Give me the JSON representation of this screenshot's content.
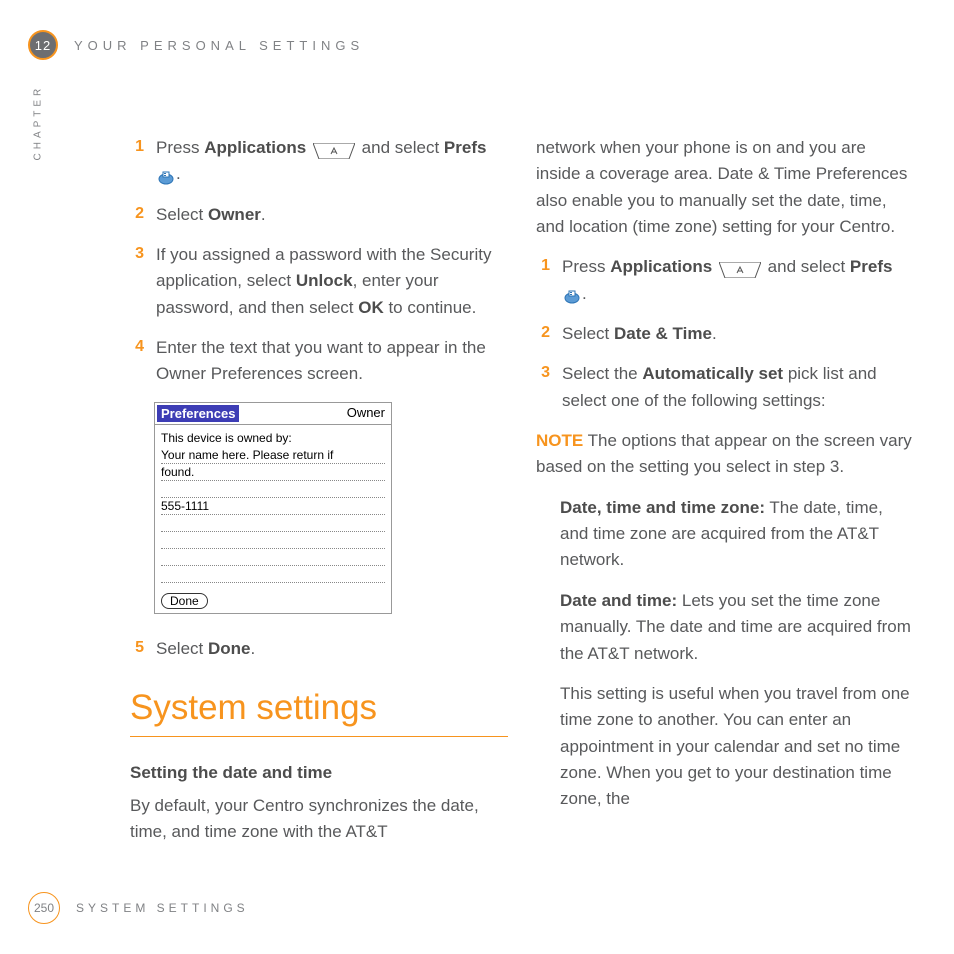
{
  "header": {
    "chapter_number": "12",
    "title": "YOUR PERSONAL SETTINGS",
    "chapter_label": "CHAPTER"
  },
  "footer": {
    "page_number": "250",
    "title": "SYSTEM SETTINGS"
  },
  "left": {
    "steps": {
      "s1": {
        "n": "1",
        "a": "Press ",
        "b": "Applications",
        "c": " and select ",
        "d": "Prefs",
        "e": "."
      },
      "s2": {
        "n": "2",
        "a": "Select ",
        "b": "Owner",
        "c": "."
      },
      "s3": {
        "n": "3",
        "a": "If you assigned a password with the Security application, select ",
        "b": "Unlock",
        "c": ", enter your password, and then select ",
        "d": "OK",
        "e": " to continue."
      },
      "s4": {
        "n": "4",
        "a": "Enter the text that you want to appear in the Owner Preferences screen."
      },
      "s5": {
        "n": "5",
        "a": "Select ",
        "b": "Done",
        "c": "."
      }
    },
    "h2": "System settings",
    "h3": "Setting the date and time",
    "intro": "By default, your Centro synchronizes the date, time, and time zone with the AT&T"
  },
  "screenshot": {
    "title_left": "Preferences",
    "title_right": "Owner",
    "label": "This device is owned by:",
    "line1": "Your name here. Please return if",
    "line2": "found.",
    "line3": "555-1111",
    "done": "Done"
  },
  "right": {
    "cont": "network when your phone is on and you are inside a coverage area. Date & Time Preferences also enable you to manually set the date, time, and location (time zone) setting for your Centro.",
    "steps": {
      "s1": {
        "n": "1",
        "a": "Press ",
        "b": "Applications",
        "c": " and select ",
        "d": "Prefs",
        "e": "."
      },
      "s2": {
        "n": "2",
        "a": "Select ",
        "b": "Date & Time",
        "c": "."
      },
      "s3": {
        "n": "3",
        "a": "Select the ",
        "b": "Automatically set",
        "c": " pick list and select one of the following settings:"
      }
    },
    "note_label": "NOTE",
    "note_text": " The options that appear on the screen vary based on the setting you select in step 3.",
    "opt1": {
      "label": "Date, time and time zone:",
      "text": " The date, time, and time zone are acquired from the AT&T network."
    },
    "opt2": {
      "label": "Date and time:",
      "text": " Lets you set the time zone manually. The date and time are acquired from the AT&T network."
    },
    "opt3": "This setting is useful when you travel from one time zone to another. You can enter an appointment in your calendar and set no time zone. When you get to your destination time zone, the"
  }
}
